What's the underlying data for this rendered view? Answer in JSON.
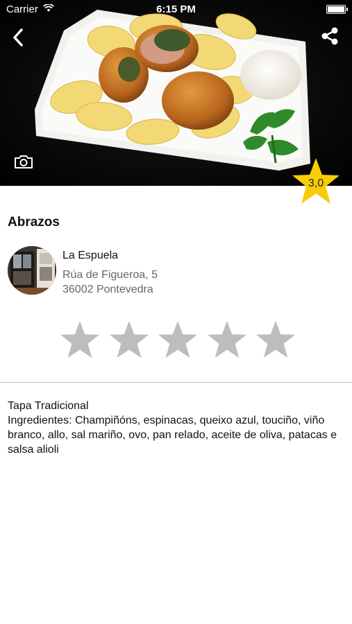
{
  "status_bar": {
    "carrier": "Carrier",
    "time": "6:15 PM"
  },
  "hero": {
    "rating": "3,0",
    "rating_color": "#F7CD06"
  },
  "tapa": {
    "name": "Abrazos"
  },
  "venue": {
    "name": "La Espuela",
    "address_line1": "Rúa de Figueroa, 5",
    "address_line2": "36002 Pontevedra"
  },
  "user_rating": {
    "max_stars": 5,
    "filled_stars": 0,
    "star_color": "#BDBDBD"
  },
  "description": {
    "type": "Tapa Tradicional",
    "ingredients": "Ingredientes: Champiñóns, espinacas, queixo azul, touciño, viño branco, allo, sal mariño, ovo, pan relado, aceite de oliva, patacas e salsa alioli"
  }
}
